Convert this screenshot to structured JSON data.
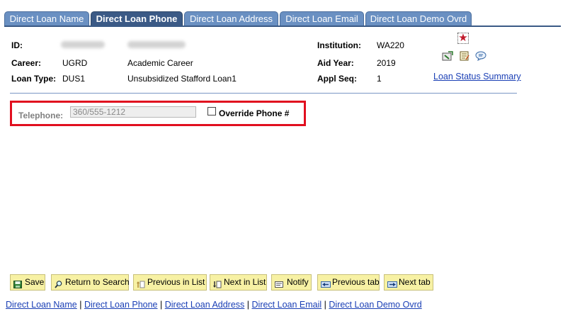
{
  "tabs": [
    {
      "label": "Direct Loan Name",
      "active": false
    },
    {
      "label": "Direct Loan Phone",
      "active": true
    },
    {
      "label": "Direct Loan Address",
      "active": false
    },
    {
      "label": "Direct Loan Email",
      "active": false
    },
    {
      "label": "Direct Loan Demo Ovrd",
      "active": false
    }
  ],
  "header": {
    "id_label": "ID:",
    "career_label": "Career:",
    "career_value": "UGRD",
    "career_desc": "Academic Career",
    "loan_type_label": "Loan Type:",
    "loan_type_value": "DUS1",
    "loan_type_desc": "Unsubsidized Stafford Loan1",
    "institution_label": "Institution:",
    "institution_value": "WA220",
    "aid_year_label": "Aid Year:",
    "aid_year_value": "2019",
    "appl_seq_label": "Appl Seq:",
    "appl_seq_value": "1",
    "loan_status_link": "Loan Status Summary"
  },
  "phone": {
    "telephone_label": "Telephone:",
    "telephone_value": "360/555-1212",
    "override_label": "Override Phone #",
    "override_checked": false
  },
  "toolbar": {
    "save": "Save",
    "return_to_search": "Return to Search",
    "previous_in_list": "Previous in List",
    "next_in_list": "Next in List",
    "notify": "Notify",
    "previous_tab": "Previous tab",
    "next_tab": "Next tab"
  },
  "bottom_links": {
    "l1": "Direct Loan Name",
    "l2": "Direct Loan Phone",
    "l3": "Direct Loan Address",
    "l4": "Direct Loan Email",
    "l5": "Direct Loan Demo Ovrd",
    "separator": "|"
  },
  "colors": {
    "tab_inactive": "#6a90c2",
    "tab_active": "#3b5a86",
    "highlight_border": "#e10f1f",
    "toolbar_button": "#f7f1a4",
    "link": "#1a3fb5"
  },
  "icons": [
    "favorite-star-icon",
    "edit-note-icon",
    "notepad-icon",
    "comment-bubble-icon",
    "save-icon",
    "search-icon",
    "previous-list-icon",
    "next-list-icon",
    "notify-icon",
    "previous-tab-icon",
    "next-tab-icon"
  ]
}
